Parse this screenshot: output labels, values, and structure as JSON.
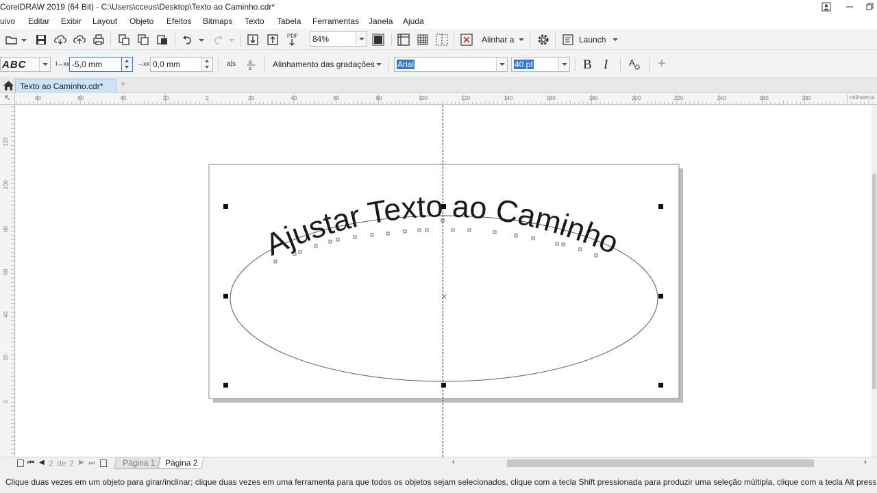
{
  "window": {
    "title": "CorelDRAW 2019 (64 Bit) - C:\\Users\\cceus\\Desktop\\Texto ao Caminho.cdr*"
  },
  "menu": [
    "uivo",
    "Editar",
    "Exibir",
    "Layout",
    "Objeto",
    "Efeitos",
    "Bitmaps",
    "Texto",
    "Tabela",
    "Ferramentas",
    "Janela",
    "Ajuda"
  ],
  "toolbar": {
    "zoom_value": "84%",
    "pdf_label": "PDF",
    "align_label": "Alinhar a",
    "launch_label": "Launch"
  },
  "property_bar": {
    "preset_label": "ABC",
    "distance_icon_label": "I↔xx",
    "distance_value": "-5,0 mm",
    "offset_icon_label": "→xx",
    "offset_value": "0,0 mm",
    "mirror_h_label": "a|s",
    "alignment_label": "Alinhamento das gradações",
    "font_value": "Arial",
    "size_value": "40 pt",
    "bold_label": "B",
    "italic_label": "I",
    "char_format_label": "A",
    "add_label": "+"
  },
  "document_tab": {
    "name": "Texto ao Caminho.cdr*",
    "add_label": "+"
  },
  "ruler": {
    "h_ticks": [
      "80",
      "60",
      "40",
      "20",
      "0",
      "20",
      "40",
      "60",
      "80",
      "100",
      "120",
      "140",
      "160",
      "180",
      "200",
      "220",
      "240",
      "260",
      "280"
    ],
    "unit": "milimetros",
    "v_ticks": [
      "120",
      "100",
      "80",
      "60",
      "40",
      "20",
      "0"
    ]
  },
  "canvas": {
    "path_text": "Ajustar Texto ao Caminho"
  },
  "page_nav": {
    "current": "2",
    "of_label": "de",
    "total": "2",
    "pages": [
      "Página 1",
      "Página 2"
    ]
  },
  "status": {
    "message": "Clique duas vezes em um objeto para girar/inclinar; clique duas vezes em uma ferramenta para que todos os objetos sejam selecionados, clique com a tecla Shift pressionada para produzir uma seleção múltipla, clique com a tecla Alt pressionada pa"
  },
  "colors": {
    "selection": "#3478d4",
    "guide": "#1a1a80",
    "text": "#222222"
  }
}
